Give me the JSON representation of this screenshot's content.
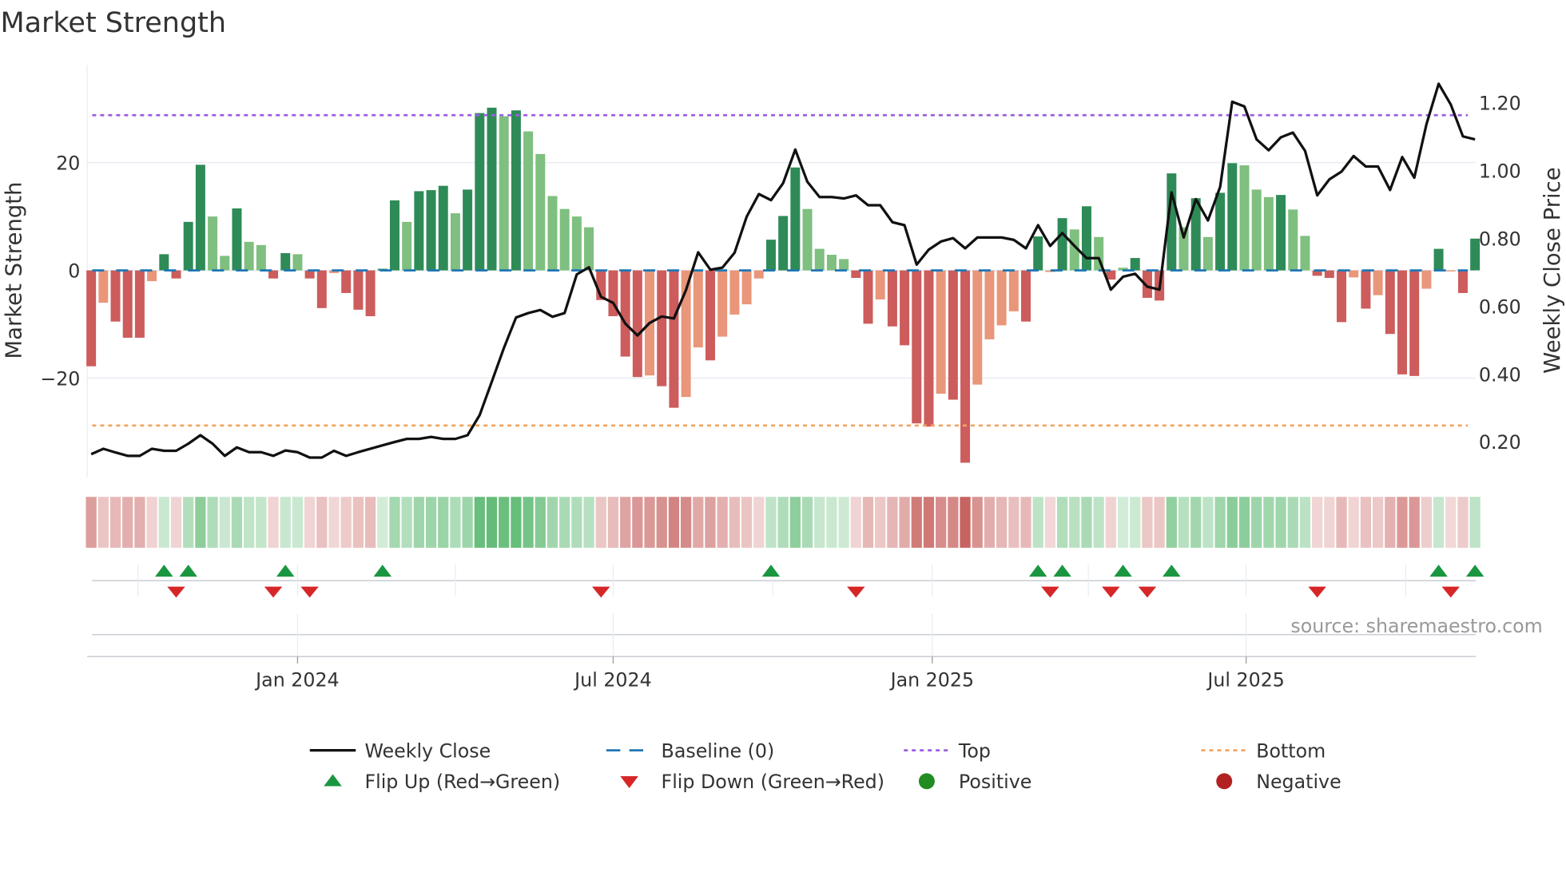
{
  "chart_data": {
    "type": "bar",
    "title": "Market Strength",
    "ylabel": "Market Strength",
    "y2label": "Weekly Close Price",
    "ylim": [
      -38,
      38
    ],
    "y2lim": [
      0.12,
      1.33
    ],
    "yticks": [
      {
        "v": 20,
        "label": "20"
      },
      {
        "v": 0,
        "label": "0"
      },
      {
        "v": -20,
        "label": "−20"
      }
    ],
    "y2ticks": [
      {
        "v": 1.2,
        "label": "1.20"
      },
      {
        "v": 1.0,
        "label": "1.00"
      },
      {
        "v": 0.8,
        "label": "0.80"
      },
      {
        "v": 0.6,
        "label": "0.60"
      },
      {
        "v": 0.4,
        "label": "0.40"
      },
      {
        "v": 0.2,
        "label": "0.20"
      }
    ],
    "xticks": [
      {
        "date": "2024-01-01",
        "label": "Jan 2024"
      },
      {
        "date": "2024-07-01",
        "label": "Jul 2024"
      },
      {
        "date": "2025-01-01",
        "label": "Jan 2025"
      },
      {
        "date": "2025-07-01",
        "label": "Jul 2025"
      }
    ],
    "minor_xgrid": [
      "2023-10-01",
      "2024-04-01",
      "2024-10-01",
      "2025-04-01",
      "2025-10-01"
    ],
    "grid": true,
    "top_level": 28.8,
    "bottom_level": -28.8,
    "baseline": 0,
    "strength": [
      -17.8,
      -6,
      -9.5,
      -12.5,
      -12.5,
      -2,
      3,
      -1.5,
      9,
      19.6,
      10,
      2.7,
      11.5,
      5.3,
      4.7,
      -1.5,
      3.2,
      3,
      -1.5,
      -7,
      -0.5,
      -4.2,
      -7.3,
      -8.5,
      0.3,
      13,
      9,
      14.7,
      14.9,
      15.7,
      10.6,
      15,
      29.2,
      30.2,
      28.6,
      29.7,
      25.8,
      21.6,
      13.8,
      11.4,
      10,
      8,
      -5.5,
      -8.5,
      -16,
      -19.8,
      -19.5,
      -21.5,
      -25.5,
      -23.5,
      -14.3,
      -16.7,
      -12.3,
      -8.2,
      -6.3,
      -1.5,
      5.7,
      10.1,
      19.1,
      11.4,
      4,
      2.9,
      2.1,
      -1.4,
      -9.9,
      -5.4,
      -10.4,
      -13.9,
      -28.4,
      -29,
      -22.9,
      -24,
      -35.7,
      -21.2,
      -12.8,
      -10.2,
      -7.6,
      -9.5,
      6.3,
      -0.3,
      9.7,
      7.6,
      11.9,
      6.2,
      -1.7,
      0.5,
      2.3,
      -5.1,
      -5.6,
      18,
      8,
      13.4,
      6.2,
      14.4,
      19.9,
      19.5,
      15,
      13.6,
      14,
      11.3,
      6.4,
      -1,
      -1.4,
      -9.6,
      -1.3,
      -7.1,
      -4.6,
      -11.8,
      -19.3,
      -19.6,
      -3.4,
      4,
      -0.2,
      -4.2,
      5.9
    ],
    "strengthening": [
      1,
      0,
      1,
      1,
      1,
      0,
      1,
      1,
      1,
      1,
      0,
      0,
      1,
      0,
      0,
      1,
      1,
      0,
      1,
      1,
      0,
      1,
      1,
      1,
      1,
      1,
      0,
      1,
      1,
      1,
      0,
      1,
      1,
      1,
      0,
      1,
      0,
      0,
      0,
      0,
      0,
      0,
      1,
      1,
      1,
      1,
      0,
      1,
      1,
      0,
      0,
      1,
      0,
      0,
      0,
      0,
      1,
      1,
      1,
      0,
      0,
      0,
      0,
      1,
      1,
      0,
      1,
      1,
      1,
      1,
      0,
      1,
      1,
      0,
      0,
      0,
      0,
      1,
      1,
      0,
      1,
      0,
      1,
      0,
      1,
      0,
      1,
      1,
      1,
      1,
      0,
      1,
      0,
      1,
      1,
      0,
      0,
      0,
      1,
      0,
      0,
      1,
      1,
      1,
      0,
      1,
      0,
      1,
      1,
      1,
      0,
      1,
      0,
      1,
      1
    ],
    "weekly_close": [
      0.164,
      0.18,
      0.169,
      0.159,
      0.159,
      0.18,
      0.174,
      0.174,
      0.195,
      0.22,
      0.195,
      0.159,
      0.184,
      0.17,
      0.17,
      0.159,
      0.175,
      0.17,
      0.154,
      0.154,
      0.174,
      0.159,
      0.17,
      0.18,
      0.19,
      0.2,
      0.209,
      0.209,
      0.215,
      0.209,
      0.209,
      0.22,
      0.279,
      0.378,
      0.477,
      0.567,
      0.58,
      0.589,
      0.569,
      0.58,
      0.694,
      0.715,
      0.628,
      0.61,
      0.549,
      0.514,
      0.551,
      0.57,
      0.564,
      0.648,
      0.759,
      0.708,
      0.714,
      0.758,
      0.864,
      0.931,
      0.913,
      0.963,
      1.062,
      0.967,
      0.922,
      0.922,
      0.918,
      0.927,
      0.898,
      0.898,
      0.848,
      0.839,
      0.723,
      0.767,
      0.791,
      0.801,
      0.771,
      0.803,
      0.803,
      0.803,
      0.796,
      0.771,
      0.839,
      0.778,
      0.816,
      0.778,
      0.742,
      0.742,
      0.649,
      0.687,
      0.696,
      0.658,
      0.649,
      0.936,
      0.803,
      0.916,
      0.853,
      0.952,
      1.203,
      1.189,
      1.092,
      1.06,
      1.098,
      1.112,
      1.058,
      0.927,
      0.974,
      0.997,
      1.043,
      1.012,
      1.012,
      0.943,
      1.04,
      0.979,
      1.137,
      1.256,
      1.195,
      1.101,
      1.092
    ],
    "flip_up_weeks": [
      7,
      9,
      17,
      25,
      57,
      79,
      81,
      86,
      90,
      112,
      115
    ],
    "flip_down_weeks": [
      8,
      16,
      19,
      43,
      64,
      80,
      85,
      88,
      102,
      113
    ],
    "legend_position": "bottom",
    "legend": [
      {
        "key": "close",
        "label": "Weekly Close"
      },
      {
        "key": "baseline",
        "label": "Baseline (0)"
      },
      {
        "key": "top",
        "label": "Top"
      },
      {
        "key": "bottom",
        "label": "Bottom"
      },
      {
        "key": "flipup",
        "label": "Flip Up (Red→Green)"
      },
      {
        "key": "flipdown",
        "label": "Flip Down (Green→Red)"
      },
      {
        "key": "positive",
        "label": "Positive"
      },
      {
        "key": "negative",
        "label": "Negative"
      }
    ],
    "source": "source: sharemaestro.com"
  },
  "colors": {
    "green_dark": "#2e8b57",
    "green_light": "#7fbf7f",
    "red_dark": "#cd5c5c",
    "red_light": "#e9967a",
    "baseline": "#1f77b4",
    "top": "#9b5fe0",
    "bottom": "#f4a460",
    "line": "#111111",
    "flip_up": "#1a9641",
    "flip_down": "#d62728",
    "positive": "#228b22",
    "negative": "#b22222",
    "grid": "#e8ecf2"
  }
}
